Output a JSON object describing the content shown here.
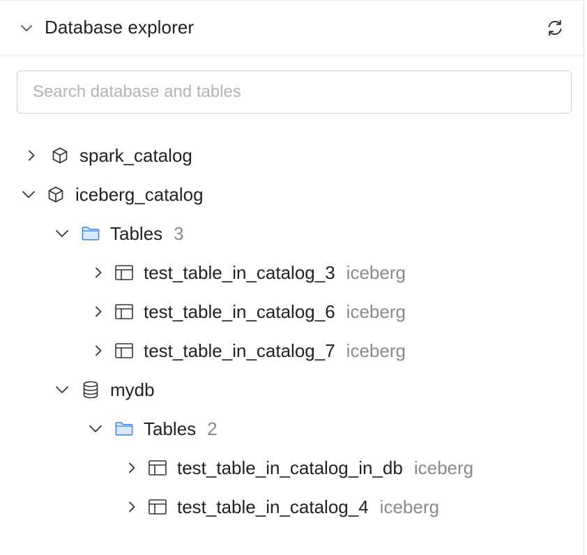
{
  "header": {
    "title": "Database explorer"
  },
  "search": {
    "placeholder": "Search database and tables",
    "value": ""
  },
  "tree": {
    "catalogs": [
      {
        "name": "spark_catalog",
        "expanded": false
      },
      {
        "name": "iceberg_catalog",
        "expanded": true,
        "tables_group": {
          "label": "Tables",
          "count": "3",
          "tables": [
            {
              "name": "test_table_in_catalog_3",
              "format": "iceberg"
            },
            {
              "name": "test_table_in_catalog_6",
              "format": "iceberg"
            },
            {
              "name": "test_table_in_catalog_7",
              "format": "iceberg"
            }
          ]
        },
        "databases": [
          {
            "name": "mydb",
            "expanded": true,
            "tables_group": {
              "label": "Tables",
              "count": "2",
              "tables": [
                {
                  "name": "test_table_in_catalog_in_db",
                  "format": "iceberg"
                },
                {
                  "name": "test_table_in_catalog_4",
                  "format": "iceberg"
                }
              ]
            }
          }
        ]
      }
    ]
  },
  "colors": {
    "folder_fill": "#d7e8ff",
    "folder_stroke": "#3b82f6",
    "muted_text": "#8a8a8a",
    "icon": "#333333"
  },
  "icons": [
    "chevron-down-icon",
    "refresh-icon",
    "chevron-right-icon",
    "cube-icon",
    "folder-icon",
    "table-icon",
    "database-icon"
  ]
}
